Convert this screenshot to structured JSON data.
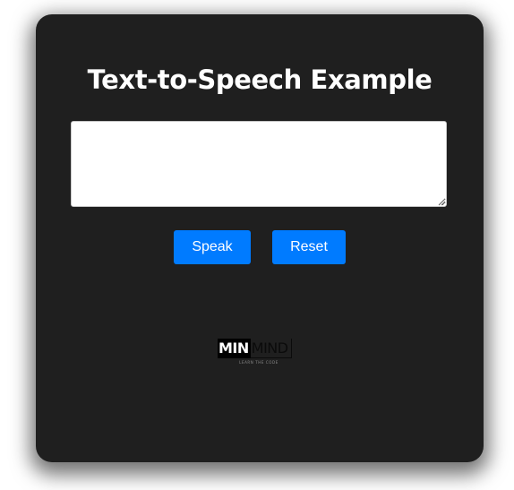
{
  "app": {
    "title": "Text-to-Speech Example"
  },
  "input": {
    "value": "",
    "placeholder": ""
  },
  "buttons": {
    "speak_label": "Speak",
    "reset_label": "Reset"
  },
  "logo": {
    "word_bold": "MIN",
    "word_light": "MIND",
    "tagline": "LEARN THE CODE"
  },
  "colors": {
    "card_background": "#1f1f1f",
    "button_accent": "#007bff",
    "title_text": "#ffffff"
  },
  "icons": {
    "resize_handle": "resize-grip-icon"
  }
}
